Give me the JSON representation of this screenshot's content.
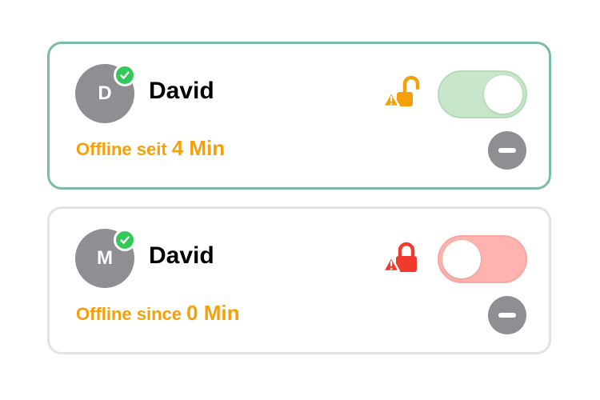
{
  "cards": [
    {
      "avatar_initial": "D",
      "name": "David",
      "status_label": "Offline seit",
      "status_value": "4 Min",
      "lock_state": "unlocked-warning",
      "lock_color": "#f5a00a",
      "toggle_on": true,
      "toggle_color": "#c8e6c9",
      "remove_icon": "minus-circle-icon"
    },
    {
      "avatar_initial": "M",
      "name": "David",
      "status_label": "Offline since",
      "status_value": "0 Min",
      "lock_state": "locked-warning",
      "lock_color": "#f03a2e",
      "toggle_on": false,
      "toggle_color": "#ffb3ae",
      "remove_icon": "minus-circle-icon"
    }
  ],
  "colors": {
    "active_border": "#7dbba9",
    "inactive_border": "#e3e3e3",
    "status_text": "#f5a00a",
    "check_badge": "#34c759",
    "avatar_bg": "#8e8e93"
  }
}
